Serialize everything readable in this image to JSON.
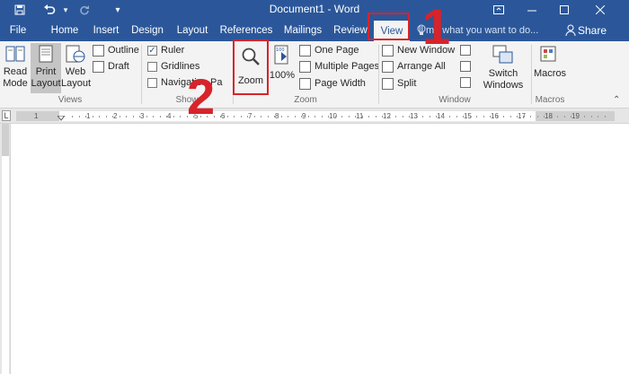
{
  "window": {
    "title": "Document1 - Word"
  },
  "quick_access": [
    "save-icon",
    "undo-icon",
    "redo-icon",
    "customize-icon"
  ],
  "tabs": [
    {
      "label": "File"
    },
    {
      "label": "Home"
    },
    {
      "label": "Insert"
    },
    {
      "label": "Design"
    },
    {
      "label": "Layout"
    },
    {
      "label": "References"
    },
    {
      "label": "Mailings"
    },
    {
      "label": "Review"
    },
    {
      "label": "View",
      "active": true
    }
  ],
  "tell_me": {
    "placeholder": "ll me what you want to do..."
  },
  "share": {
    "label": "Share"
  },
  "ribbon": {
    "views": {
      "label": "Views",
      "read_mode": "Read Mode",
      "print_layout": "Print Layout",
      "web_layout": "Web Layout",
      "outline": "Outline",
      "draft": "Draft"
    },
    "show": {
      "label": "Show",
      "ruler": "Ruler",
      "gridlines": "Gridlines",
      "navigation_pane": "Navigation Pa",
      "ruler_checked": true,
      "gridlines_checked": false,
      "navigation_checked": false
    },
    "zoom": {
      "label": "Zoom",
      "zoom": "Zoom",
      "hundred": "100%",
      "one_page": "One Page",
      "multiple_pages": "Multiple Pages",
      "page_width": "Page Width"
    },
    "window": {
      "label": "Window",
      "new_window": "New Window",
      "arrange_all": "Arrange All",
      "split": "Split",
      "switch_windows": "Switch Windows"
    },
    "macros": {
      "label": "Macros",
      "macros": "Macros"
    }
  },
  "annotations": {
    "step1": "1",
    "step2": "2",
    "color": "#d8232a"
  },
  "ruler_ticks": [
    "1",
    "1",
    "2",
    "3",
    "4",
    "5",
    "6",
    "7",
    "8",
    "9",
    "10",
    "11",
    "12",
    "13",
    "14",
    "15",
    "16",
    "17",
    "18",
    "19"
  ],
  "colors": {
    "accent": "#2b579a",
    "ribbon_bg": "#f3f3f3",
    "highlight": "#d8232a"
  }
}
